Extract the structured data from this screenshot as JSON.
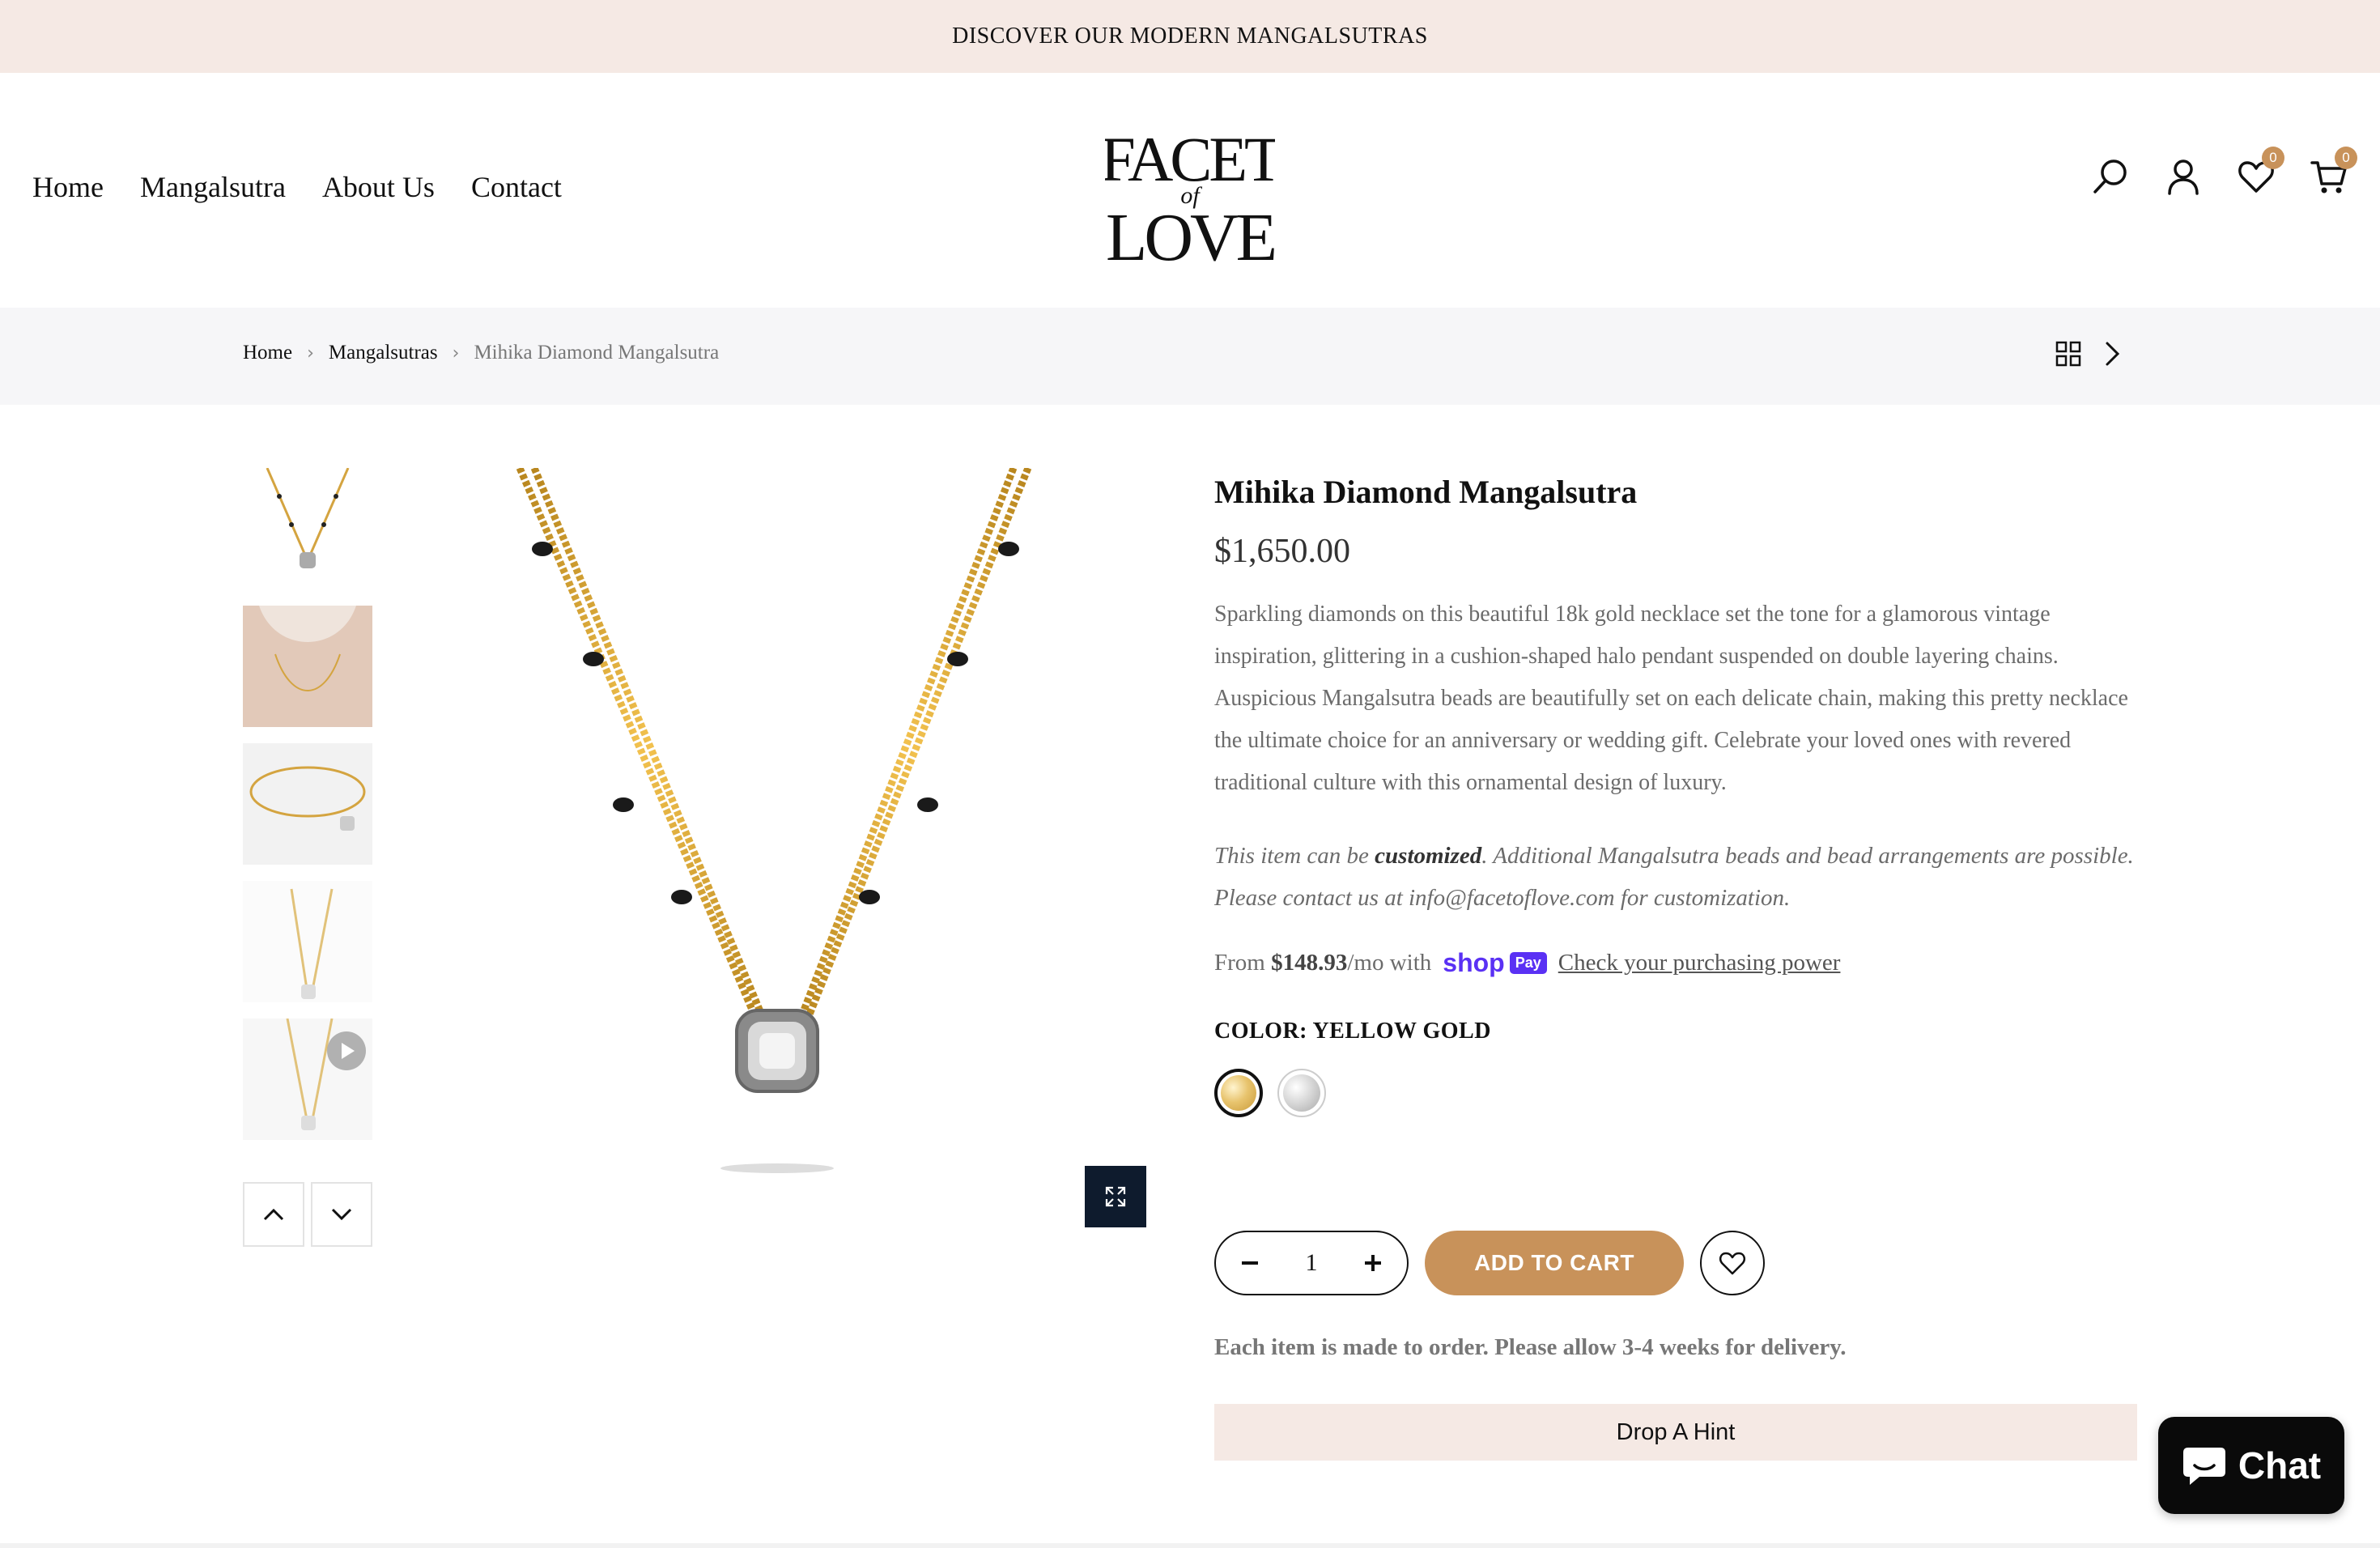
{
  "announcement": "DISCOVER OUR MODERN MANGALSUTRAS",
  "nav": [
    "Home",
    "Mangalsutra",
    "About Us",
    "Contact"
  ],
  "logo": {
    "line1": "FACET",
    "line2": "of",
    "line3": "LOVE"
  },
  "header_icons": {
    "search": "search-icon",
    "account": "user-icon",
    "wishlist": "heart-icon",
    "cart": "cart-icon"
  },
  "badges": {
    "wishlist_count": "0",
    "cart_count": "0"
  },
  "breadcrumb": [
    "Home",
    "Mangalsutras",
    "Mihika Diamond Mangalsutra"
  ],
  "product": {
    "title": "Mihika Diamond Mangalsutra",
    "price": "$1,650.00",
    "description": "Sparkling diamonds on this beautiful 18k gold necklace set the tone for a glamorous vintage inspiration, glittering in a cushion-shaped halo pendant suspended on double layering chains. Auspicious Mangalsutra beads are beautifully set on each delicate chain, making this pretty necklace the ultimate choice for an anniversary or wedding gift. Celebrate your loved ones with revered traditional culture with this ornamental design of luxury.",
    "custom_prefix": "This item can be ",
    "custom_bold": "customized",
    "custom_suffix": ". Additional Mangalsutra beads and bead arrangements are possible. Please contact us at info@facetoflove.com for customization.",
    "installments_prefix": "From ",
    "installments_amount": "$148.93",
    "installments_mid": "/mo with",
    "shop_logo": "shop",
    "shop_pay": "Pay",
    "installments_link": "Check your purchasing power",
    "color_label": "COLOR: YELLOW GOLD",
    "colors": [
      "Yellow Gold",
      "White Gold"
    ],
    "quantity": "1",
    "add_to_cart": "ADD TO CART",
    "delivery_note": "Each item is made to order. Please allow 3-4 weeks for delivery.",
    "hint_button": "Drop A Hint"
  },
  "chat": "Chat",
  "colors": {
    "accent": "#c8925a",
    "announce_bg": "#f5e9e4",
    "expand_bg": "#0e1b2d",
    "shoppay": "#5a31f4"
  }
}
